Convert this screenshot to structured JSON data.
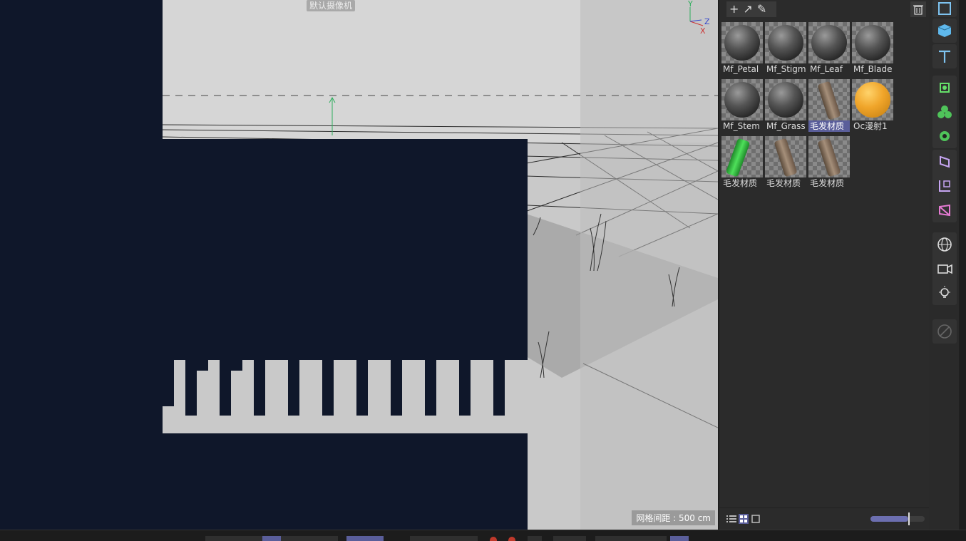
{
  "viewport": {
    "camera_label": "默认摄像机",
    "grid_spacing": "网格间距 : 500 cm",
    "axis_labels": {
      "y": "Y",
      "z": "Z",
      "x": "X"
    }
  },
  "material_manager": {
    "toolbar": {
      "add": "+",
      "arrow": "↗",
      "picker": "✎"
    },
    "materials": [
      {
        "name": "Mf_Petal",
        "kind": "sphere"
      },
      {
        "name": "Mf_Stigm",
        "kind": "sphere"
      },
      {
        "name": "Mf_Leaf",
        "kind": "sphere"
      },
      {
        "name": "Mf_Blade",
        "kind": "sphere"
      },
      {
        "name": "Mf_Stem",
        "kind": "sphere"
      },
      {
        "name": "Mf_Grass",
        "kind": "sphere"
      },
      {
        "name": "毛发材质",
        "kind": "hair",
        "selected": true
      },
      {
        "name": "Oc漫射1",
        "kind": "orange-sphere"
      },
      {
        "name": "毛发材质",
        "kind": "hair-green"
      },
      {
        "name": "毛发材质",
        "kind": "hair"
      },
      {
        "name": "毛发材质",
        "kind": "hair"
      }
    ],
    "zoom_level": 0.7
  },
  "right_toolbar": {
    "icons": [
      "cube-outline-icon",
      "cube-icon",
      "text-icon",
      "spline-icon",
      "mograph-icon",
      "deformer-icon",
      "effector-icon",
      "scene-icon",
      "field-icon",
      "sky-icon",
      "camera-icon",
      "light-icon",
      "disabled-icon"
    ]
  },
  "colors": {
    "accent": "#5a5e9a",
    "selection": "#5a5e9a",
    "background": "#0f172a"
  }
}
